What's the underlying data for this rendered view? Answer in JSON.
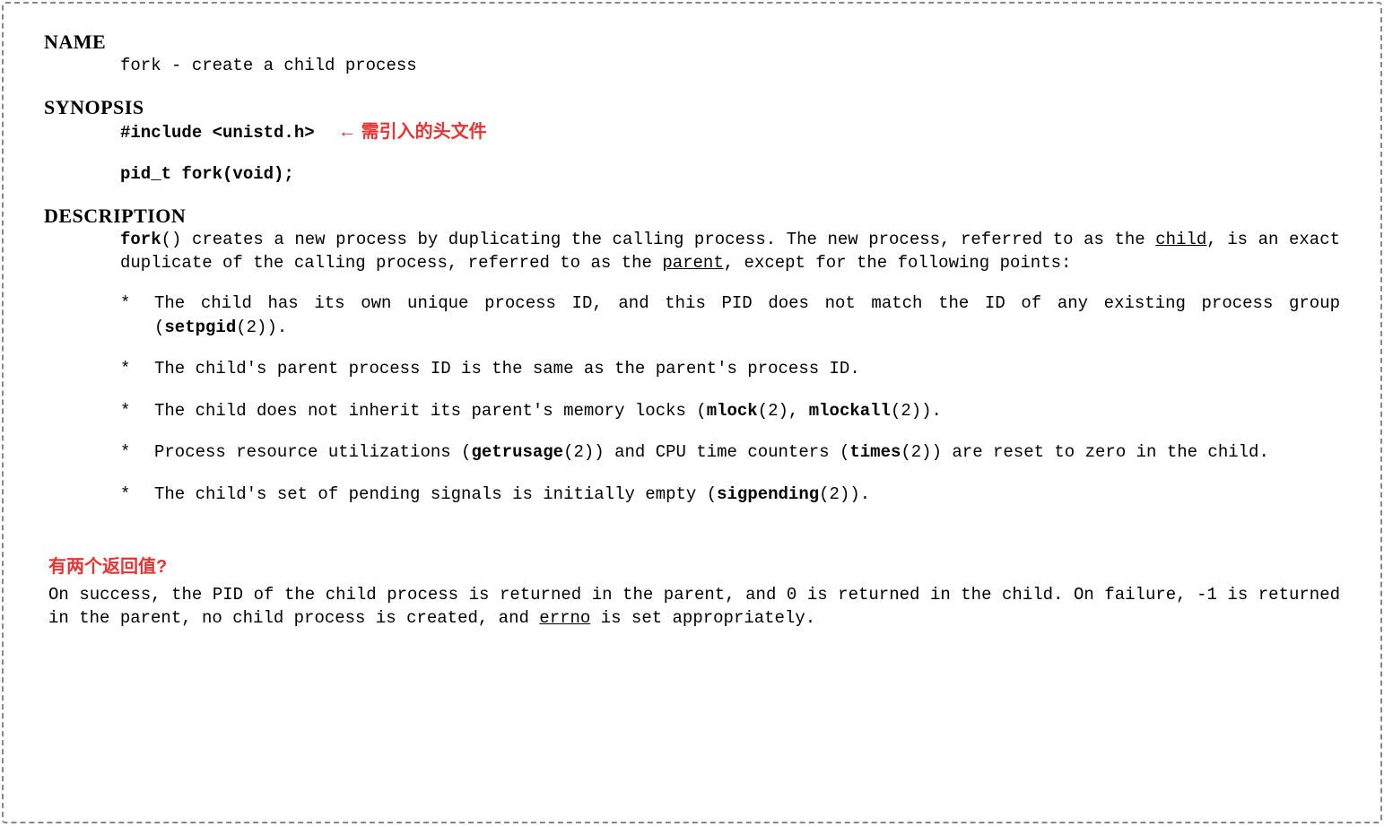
{
  "headers": {
    "name": "NAME",
    "synopsis": "SYNOPSIS",
    "description": "DESCRIPTION"
  },
  "name_line": "fork - create a child process",
  "synopsis": {
    "include": "#include <unistd.h>",
    "include_annotation_arrow": "←",
    "include_annotation": "需引入的头文件",
    "signature": "pid_t fork(void);"
  },
  "description": {
    "intro_bold": "fork",
    "intro_paren": "()",
    "intro_text1": "  creates  a new process by duplicating the calling process.  The new process, referred to as the ",
    "intro_child": "child",
    "intro_text2": ", is an exact duplicate of the calling process, referred to as the ",
    "intro_parent": "parent",
    "intro_text3": ", except for  the following points:",
    "bullets": [
      {
        "pre": "The  child  has  its  own  unique process ID, and this PID does not match the ID of any existing process group (",
        "bold": "setpgid",
        "post": "(2))."
      },
      {
        "pre": "The child's parent process ID is the same as the parent's process ID.",
        "bold": "",
        "post": ""
      },
      {
        "pre": "The child does not inherit its parent's memory locks (",
        "bold": "mlock",
        "mid": "(2), ",
        "bold2": "mlockall",
        "post": "(2))."
      },
      {
        "pre": "Process resource utilizations (",
        "bold": "getrusage",
        "mid": "(2)) and CPU time counters (",
        "bold2": "times",
        "post": "(2)) are reset to  zero in the child."
      },
      {
        "pre": "The child's set of pending signals is initially empty (",
        "bold": "sigpending",
        "post": "(2))."
      }
    ]
  },
  "return_annotation": "有两个返回值?",
  "return_value": {
    "text1": "On success, the PID of the child process is returned in the parent, and 0 is returned in the child. On failure, -1 is returned in the parent, no child process is created, and ",
    "errno": "errno",
    "text2": " is  set  appropriately."
  },
  "bullet_char": "*"
}
